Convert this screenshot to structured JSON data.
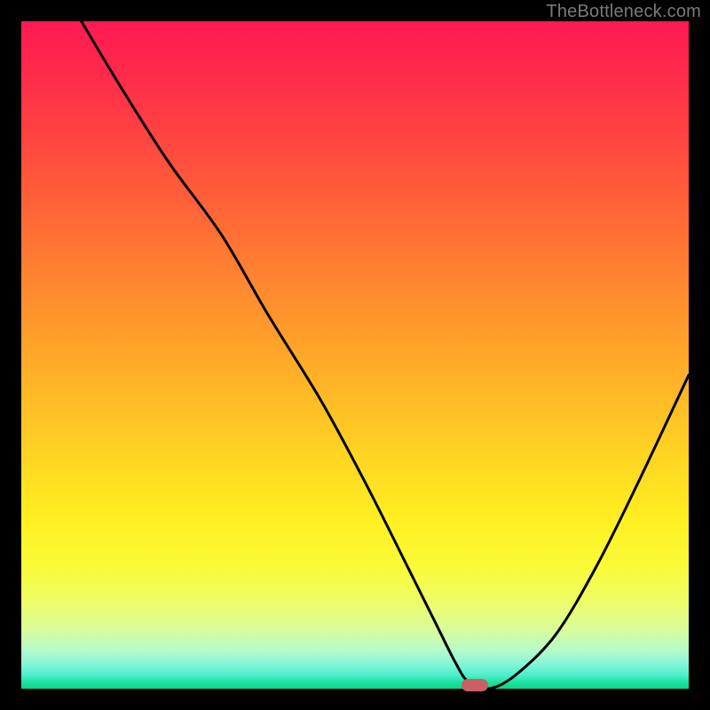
{
  "watermark": "TheBottleneck.com",
  "colors": {
    "frame": "#000000",
    "curve_stroke": "#000000",
    "marker_fill": "#cb5f63",
    "watermark_text": "#7a7a7a"
  },
  "chart_data": {
    "type": "line",
    "title": "",
    "xlabel": "",
    "ylabel": "",
    "xlim": [
      0,
      100
    ],
    "ylim": [
      0,
      100
    ],
    "grid": false,
    "series": [
      {
        "name": "bottleneck-curve",
        "x": [
          9,
          15,
          22,
          30,
          37,
          45,
          52,
          58,
          62,
          65,
          67,
          70,
          74,
          80,
          86,
          92,
          100
        ],
        "values": [
          100,
          90,
          79,
          68,
          56,
          43,
          30,
          18,
          10,
          4,
          1,
          0,
          2,
          8,
          18,
          30,
          47
        ]
      }
    ],
    "annotations": [
      {
        "name": "optimum-marker",
        "x": 68,
        "y": 0.5
      }
    ],
    "background_gradient": {
      "top": "#ff1a52",
      "mid": "#ffd423",
      "bottom": "#0bd585"
    }
  }
}
